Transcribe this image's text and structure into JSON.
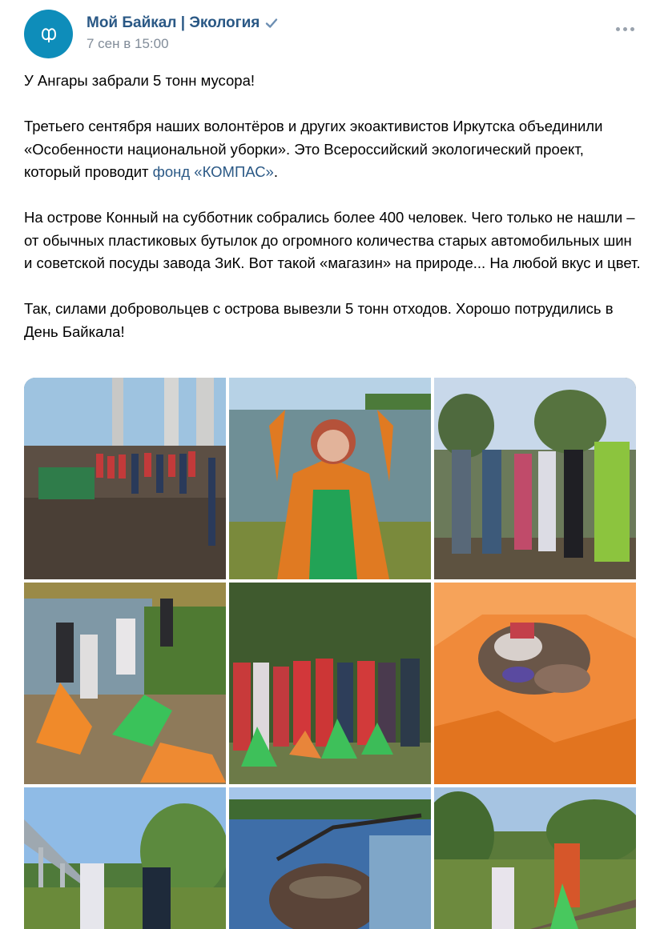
{
  "post": {
    "author": "Мой Байкал | Экология",
    "date": "7 сен в 15:00",
    "verified_icon": "checkmark-verified-icon",
    "more_icon": "more-dots-icon",
    "lines": {
      "title": "У Ангары забрали 5 тонн мусора!",
      "p1_part1": "Третьего сентября наших волонтёров и других экоактивистов Иркутска объединили «Особенности национальной уборки». Это Всероссийский экологический проект, который проводит ",
      "p1_link": "фонд «КОМПАС»",
      "p1_end": ".",
      "p2": "На острове Конный на субботник собрались более 400 человек. Чего только не нашли – от обычных пластиковых бутылок до огромного количества старых автомобильных шин и советской посуды завода ЗиК. Вот такой «магазин» на природе... На любой вкус и цвет.",
      "p3": "Так, силами добровольцев с острова вывезли 5 тонн отходов. Хорошо потрудились в День Байкала!"
    },
    "colors": {
      "link": "#2a5885",
      "date": "#818c99",
      "avatar": "#0e8dba"
    },
    "photos": [
      {
        "name": "photo-volunteers-under-bridge"
      },
      {
        "name": "photo-woman-orange-jacket"
      },
      {
        "name": "photo-group-by-trees"
      },
      {
        "name": "photo-collecting-by-river"
      },
      {
        "name": "photo-group-with-bags"
      },
      {
        "name": "photo-orange-bag-trash"
      },
      {
        "name": "photo-bridge-and-volunteers"
      },
      {
        "name": "photo-old-kettle"
      },
      {
        "name": "photo-volunteers-on-rails"
      }
    ]
  }
}
